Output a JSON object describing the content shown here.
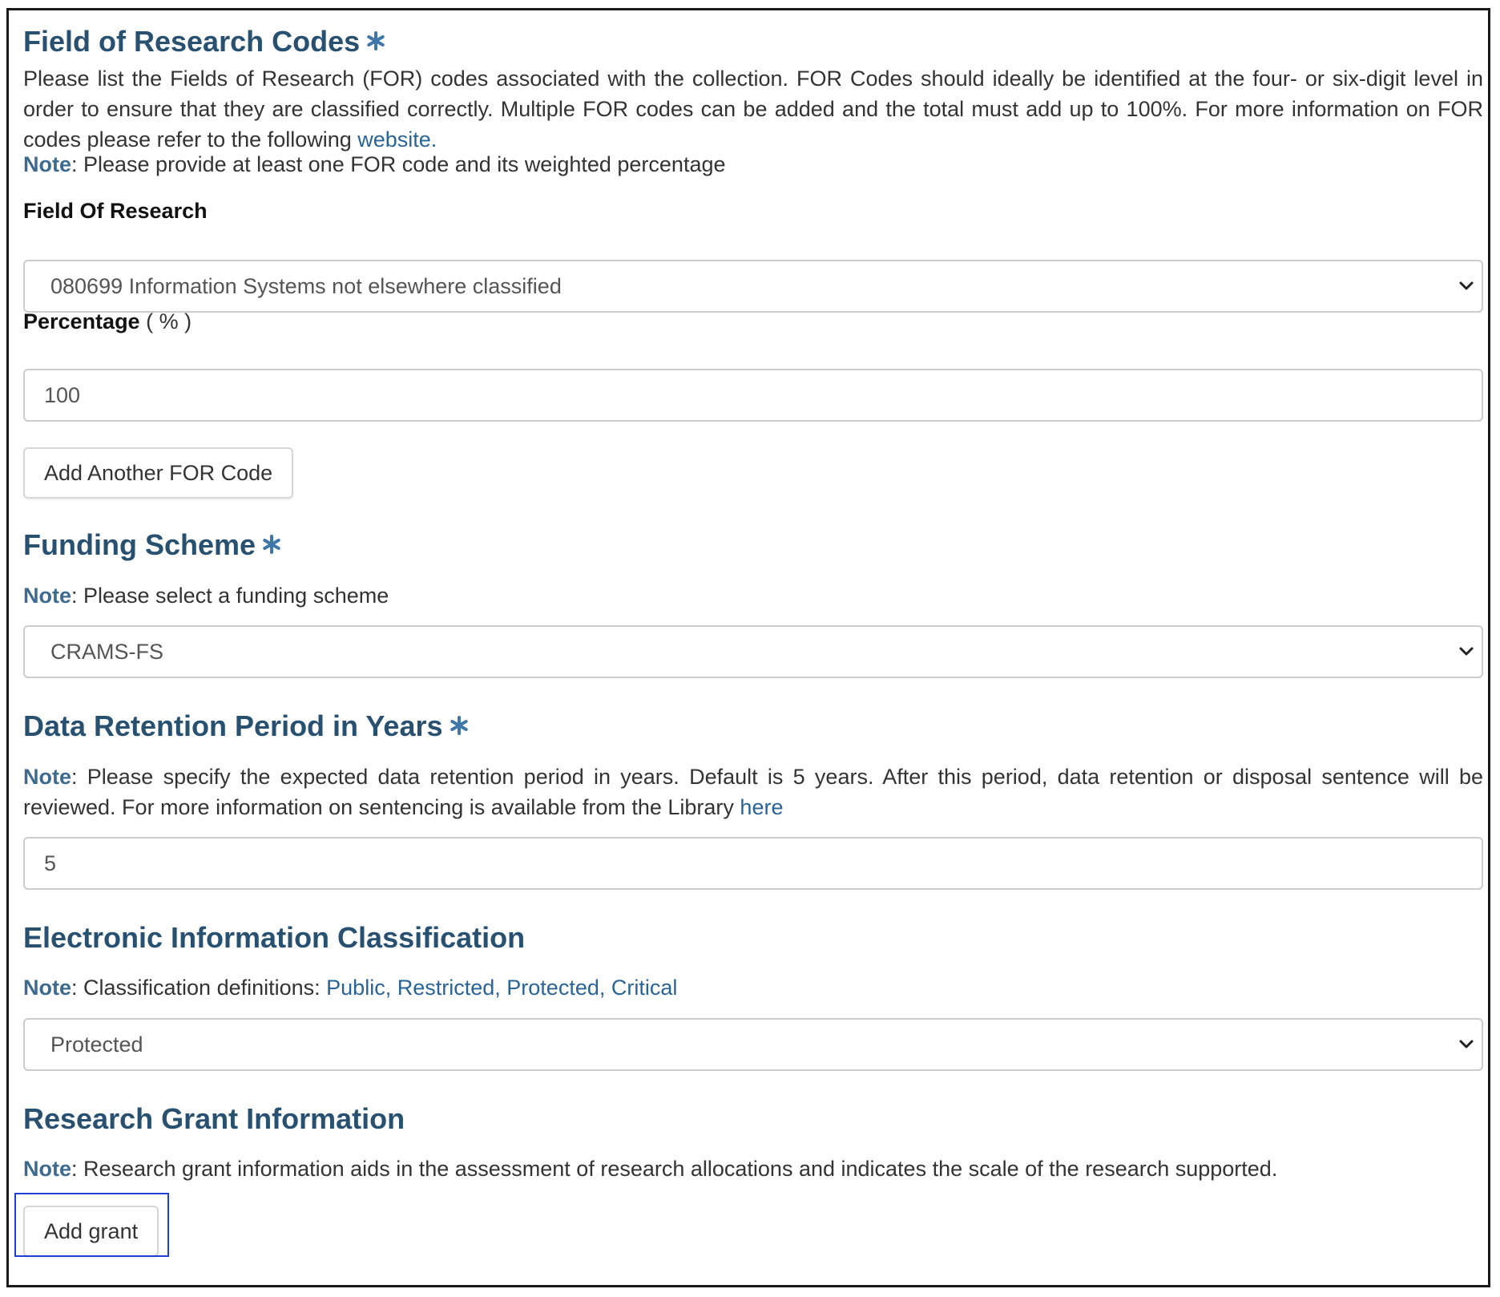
{
  "sections": {
    "for_codes": {
      "title": "Field of Research Codes",
      "description_prefix": "Please list the Fields of Research (FOR) codes associated with the collection. FOR Codes should ideally be identified at the four- or six-digit level in order to ensure that they are classified correctly. Multiple FOR codes can be added and the total must add up to 100%. For more information on FOR codes please refer to the following ",
      "description_link": "website.",
      "note_label": "Note",
      "note_text": ": Please provide at least one FOR code and its weighted percentage",
      "field_label": "Field Of Research",
      "field_value": "080699 Information Systems not elsewhere classified",
      "percentage_label": "Percentage",
      "percentage_unit": "( % )",
      "percentage_value": "100",
      "add_button": "Add Another FOR Code"
    },
    "funding": {
      "title": "Funding Scheme",
      "note_label": "Note",
      "note_text": ": Please select a funding scheme",
      "value": "CRAMS-FS"
    },
    "retention": {
      "title": "Data Retention Period in Years",
      "note_label": "Note",
      "note_text": ": Please specify the expected data retention period in years. Default is 5 years. After this period, data retention or disposal sentence will be reviewed. For more information on sentencing is available from the Library ",
      "note_link": "here",
      "value": "5"
    },
    "classification": {
      "title": "Electronic Information Classification",
      "note_label": "Note",
      "note_text": ": Classification definitions: ",
      "links": [
        "Public,",
        "Restricted,",
        "Protected,",
        "Critical"
      ],
      "value": "Protected"
    },
    "grant": {
      "title": "Research Grant Information",
      "note_label": "Note",
      "note_text": ": Research grant information aids in the assessment of research allocations and indicates the scale of the research supported.",
      "add_button": "Add grant"
    }
  },
  "icons": {
    "required": "asterisk-icon",
    "select_arrow": "chevron-down-icon"
  },
  "colors": {
    "heading": "#285070",
    "note_label": "#3d6a8e",
    "link": "#2a6496",
    "highlight": "#1f3fd6"
  }
}
